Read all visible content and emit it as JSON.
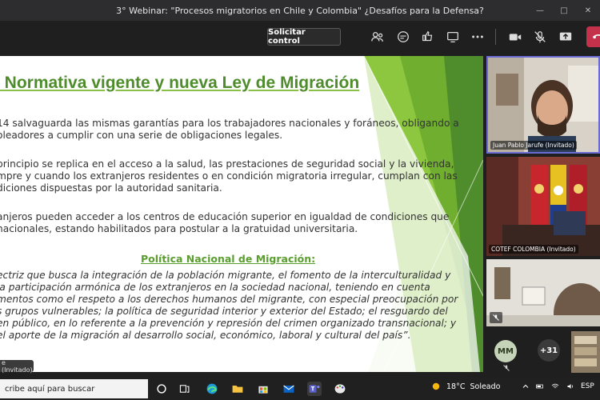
{
  "window": {
    "title": "3° Webinar: \"Procesos migratorios en Chile y Colombia\" ¿Desafíos para la Defensa?"
  },
  "toolbar": {
    "request_control_label": "Solicitar control"
  },
  "slide": {
    "title": ". Normativa vigente y nueva Ley de Migración",
    "paragraph1": [
      " 14 salvaguarda las mismas garantías para los trabajadores nacionales y foráneos, obligando a",
      "oleadores a cumplir con una serie de obligaciones legales."
    ],
    "paragraph2": [
      "principio se replica en el acceso a la salud, las prestaciones de seguridad social y la vivienda,",
      "mpre y cuando los extranjeros residentes o en condición migratoria irregular, cumplan con las",
      "diciones dispuestas por la autoridad sanitaria."
    ],
    "paragraph3": [
      "anjeros pueden acceder a los centros de educación superior en igualdad de condiciones que",
      "nacionales, estando habilitados para postular a la gratuidad universitaria."
    ],
    "subheading": "Política Nacional de Migración:",
    "quote": [
      "ectriz que busca la integración de la población migrante, el fomento de la interculturalidad y",
      " la participación armónica de los extranjeros en la sociedad nacional, teniendo en cuenta",
      "mentos como el respeto a los derechos humanos del migrante, con especial preocupación por",
      "s grupos vulnerables; la política de seguridad interior y exterior del Estado; el resguardo del",
      "en público, en lo referente a la prevención y represión del crimen organizado transnacional; y",
      " el aporte de la migración al desarrollo social, económico, laboral y cultural del país”."
    ],
    "presenter_tag": "e (Invitado)",
    "colors": {
      "title": "#4e8c2c",
      "accent": "#8dc63f"
    }
  },
  "participants": {
    "tile1_name": "Juan Pablo Jarufe (Invitado)",
    "tile2_name": "COTEF COLOMBIA (Invitado)",
    "avatar_initials": "MM",
    "more_count": "+31"
  },
  "taskbar": {
    "search_placeholder": "cribe aquí para buscar",
    "weather_temp": "18°C",
    "weather_desc": "Soleado",
    "language": "ESP"
  }
}
